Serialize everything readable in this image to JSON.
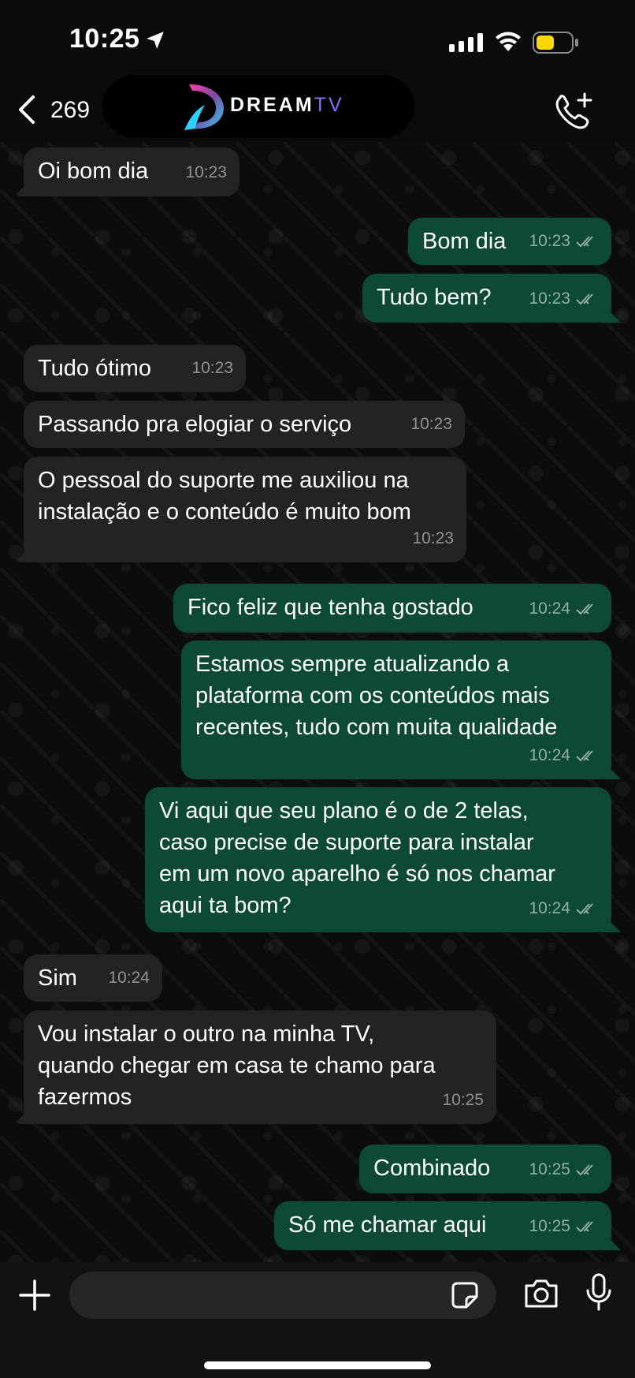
{
  "status_bar": {
    "time": "10:25",
    "battery_color": "#ffd60a"
  },
  "header": {
    "back_count": "269",
    "logo_main": "DREAM",
    "logo_suffix": "TV",
    "call_icon": "phone-plus-icon"
  },
  "messages": [
    {
      "dir": "in",
      "text": "Oi bom dia",
      "time": "10:23"
    },
    {
      "dir": "out",
      "text": "Bom dia",
      "time": "10:23"
    },
    {
      "dir": "out",
      "text": "Tudo bem?",
      "time": "10:23"
    },
    {
      "dir": "in",
      "text": "Tudo ótimo",
      "time": "10:23"
    },
    {
      "dir": "in",
      "text": "Passando pra elogiar o serviço",
      "time": "10:23"
    },
    {
      "dir": "in",
      "text": "O pessoal do suporte me auxiliou na\ninstalação e o conteúdo é muito bom",
      "time": "10:23"
    },
    {
      "dir": "out",
      "text": "Fico feliz que tenha gostado",
      "time": "10:24"
    },
    {
      "dir": "out",
      "text": "Estamos sempre atualizando a\nplataforma com os conteúdos mais\nrecentes, tudo com muita qualidade",
      "time": "10:24"
    },
    {
      "dir": "out",
      "text": "Vi aqui que seu plano é o de 2 telas,\ncaso precise de suporte para instalar\nem um novo aparelho é só nos chamar\naqui ta bom?",
      "time": "10:24"
    },
    {
      "dir": "in",
      "text": "Sim",
      "time": "10:24"
    },
    {
      "dir": "in",
      "text": "Vou instalar o outro na minha TV,\nquando chegar em casa te chamo para\nfazermos",
      "time": "10:25"
    },
    {
      "dir": "out",
      "text": "Combinado",
      "time": "10:25"
    },
    {
      "dir": "out",
      "text": "Só me chamar aqui",
      "time": "10:25"
    }
  ],
  "input_bar": {
    "placeholder": "",
    "icons": [
      "plus-icon",
      "sticker-icon",
      "camera-icon",
      "microphone-icon"
    ]
  }
}
